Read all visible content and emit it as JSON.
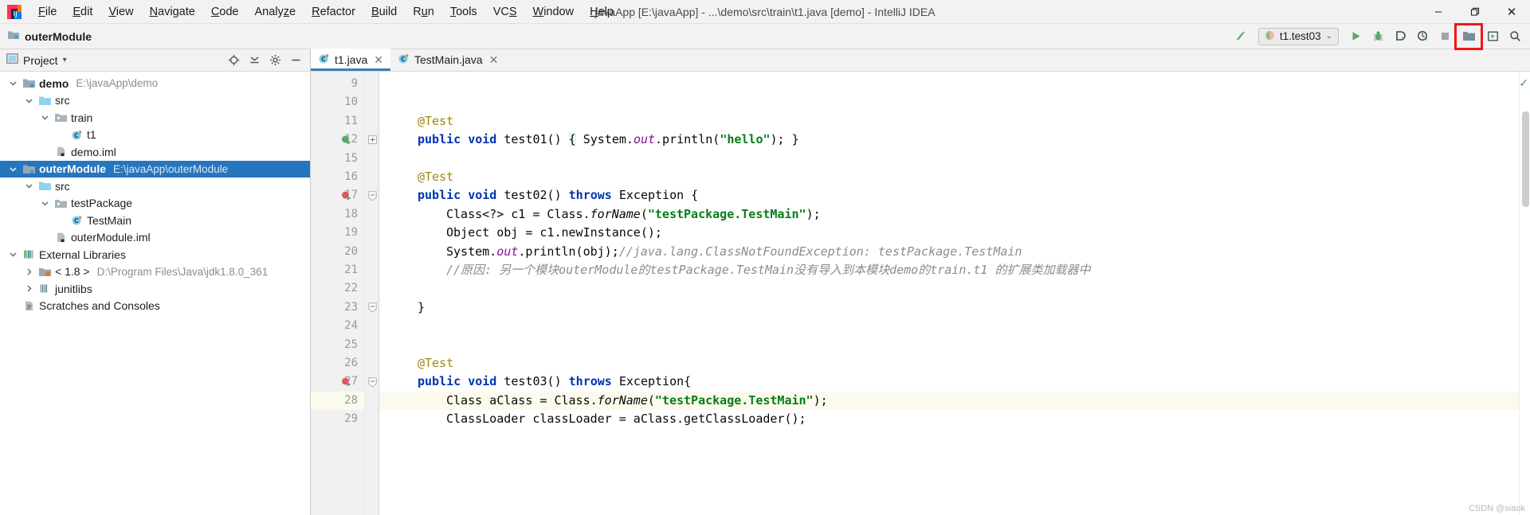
{
  "titlebar": {
    "logo_icon": "intellij-logo-icon",
    "menus": [
      {
        "label": "File",
        "mnemonic": "F"
      },
      {
        "label": "Edit",
        "mnemonic": "E"
      },
      {
        "label": "View",
        "mnemonic": "V"
      },
      {
        "label": "Navigate",
        "mnemonic": "N"
      },
      {
        "label": "Code",
        "mnemonic": "C"
      },
      {
        "label": "Analyze",
        "mnemonic": "z"
      },
      {
        "label": "Refactor",
        "mnemonic": "R"
      },
      {
        "label": "Build",
        "mnemonic": "B"
      },
      {
        "label": "Run",
        "mnemonic": "u"
      },
      {
        "label": "Tools",
        "mnemonic": "T"
      },
      {
        "label": "VCS",
        "mnemonic": "S"
      },
      {
        "label": "Window",
        "mnemonic": "W"
      },
      {
        "label": "Help",
        "mnemonic": "H"
      }
    ],
    "window_title": "javaApp [E:\\javaApp] - ...\\demo\\src\\train\\t1.java [demo] - IntelliJ IDEA",
    "minimize": "–",
    "maximize": "❐",
    "close": "✕"
  },
  "toolbar": {
    "breadcrumb_icon": "module-folder-icon",
    "breadcrumb_label": "outerModule",
    "build_icon": "build-hammer-icon",
    "run_config": {
      "icon": "junit-config-icon",
      "label": "t1.test03",
      "chevron": "⌄"
    },
    "actions": [
      {
        "name": "run-button",
        "icon": "play-icon"
      },
      {
        "name": "debug-button",
        "icon": "bug-icon"
      },
      {
        "name": "run-with-coverage-button",
        "icon": "coverage-icon"
      },
      {
        "name": "profile-button",
        "icon": "profiler-icon"
      },
      {
        "name": "stop-button",
        "icon": "stop-icon"
      },
      {
        "name": "project-structure-button",
        "icon": "project-structure-icon",
        "highlighted": true
      },
      {
        "name": "update-project-button",
        "icon": "update-icon"
      },
      {
        "name": "search-everywhere-button",
        "icon": "search-icon"
      }
    ],
    "highlight_color": "#f01616"
  },
  "project_panel": {
    "header": {
      "icon": "project-view-icon",
      "title": "Project",
      "chevron": "▾",
      "actions": [
        {
          "name": "select-opened-file-button",
          "icon": "crosshair-target-icon"
        },
        {
          "name": "collapse-all-button",
          "icon": "collapse-all-icon"
        },
        {
          "name": "settings-button",
          "icon": "gear-icon"
        },
        {
          "name": "hide-button",
          "icon": "minus-icon"
        }
      ]
    },
    "tree": [
      {
        "label": "demo",
        "path": "E:\\javaApp\\demo",
        "icon": "module-folder-icon",
        "indent": 0,
        "expanded": true,
        "bold": true,
        "selected": false
      },
      {
        "label": "src",
        "path": "",
        "icon": "source-folder-icon",
        "indent": 1,
        "expanded": true,
        "bold": false,
        "selected": false
      },
      {
        "label": "train",
        "path": "",
        "icon": "package-folder-icon",
        "indent": 2,
        "expanded": true,
        "bold": false,
        "selected": false
      },
      {
        "label": "t1",
        "path": "",
        "icon": "java-class-icon",
        "indent": 3,
        "expanded": null,
        "bold": false,
        "selected": false
      },
      {
        "label": "demo.iml",
        "path": "",
        "icon": "iml-file-icon",
        "indent": 2,
        "expanded": null,
        "bold": false,
        "selected": false
      },
      {
        "label": "outerModule",
        "path": "E:\\javaApp\\outerModule",
        "icon": "module-folder-icon",
        "indent": 0,
        "expanded": true,
        "bold": true,
        "selected": true
      },
      {
        "label": "src",
        "path": "",
        "icon": "source-folder-icon",
        "indent": 1,
        "expanded": true,
        "bold": false,
        "selected": false
      },
      {
        "label": "testPackage",
        "path": "",
        "icon": "package-folder-icon",
        "indent": 2,
        "expanded": true,
        "bold": false,
        "selected": false
      },
      {
        "label": "TestMain",
        "path": "",
        "icon": "java-class-icon",
        "indent": 3,
        "expanded": null,
        "bold": false,
        "selected": false
      },
      {
        "label": "outerModule.iml",
        "path": "",
        "icon": "iml-file-icon",
        "indent": 2,
        "expanded": null,
        "bold": false,
        "selected": false
      },
      {
        "label": "External Libraries",
        "path": "",
        "icon": "libraries-icon",
        "indent": 0,
        "expanded": true,
        "bold": false,
        "selected": false
      },
      {
        "label": "< 1.8 >",
        "path": "D:\\Program Files\\Java\\jdk1.8.0_361",
        "icon": "jdk-icon",
        "indent": 1,
        "expanded": false,
        "bold": false,
        "selected": false
      },
      {
        "label": "junitlibs",
        "path": "",
        "icon": "library-icon",
        "indent": 1,
        "expanded": false,
        "bold": false,
        "selected": false
      },
      {
        "label": "Scratches and Consoles",
        "path": "",
        "icon": "scratches-icon",
        "indent": 0,
        "expanded": null,
        "bold": false,
        "selected": false
      }
    ]
  },
  "editor": {
    "tabs": [
      {
        "label": "t1.java",
        "icon": "java-class-icon",
        "active": true,
        "close": "✕"
      },
      {
        "label": "TestMain.java",
        "icon": "java-class-icon",
        "active": false,
        "close": "✕"
      }
    ],
    "highlighted_line": 28,
    "inspection_status_icon": "check-ok-icon",
    "lines": [
      {
        "num": 9,
        "indent": 0,
        "marker": "",
        "fold": "",
        "tokens": []
      },
      {
        "num": 10,
        "indent": 0,
        "marker": "",
        "fold": "",
        "tokens": []
      },
      {
        "num": 11,
        "indent": 1,
        "marker": "",
        "fold": "",
        "tokens": [
          {
            "t": "ann",
            "s": "@Test"
          }
        ]
      },
      {
        "num": 12,
        "indent": 1,
        "marker": "run-test-green",
        "fold": "+",
        "tokens": [
          {
            "t": "kw",
            "s": "public"
          },
          {
            "t": "pl",
            "s": " "
          },
          {
            "t": "kw",
            "s": "void"
          },
          {
            "t": "pl",
            "s": " test01() "
          },
          {
            "t": "brace",
            "s": "{"
          },
          {
            "t": "pl",
            "s": " System."
          },
          {
            "t": "fld",
            "s": "out"
          },
          {
            "t": "pl",
            "s": ".println("
          },
          {
            "t": "str",
            "s": "\"hello\""
          },
          {
            "t": "pl",
            "s": "); }"
          }
        ]
      },
      {
        "num": 15,
        "indent": 0,
        "marker": "",
        "fold": "",
        "tokens": []
      },
      {
        "num": 16,
        "indent": 1,
        "marker": "",
        "fold": "",
        "tokens": [
          {
            "t": "ann",
            "s": "@Test"
          }
        ]
      },
      {
        "num": 17,
        "indent": 1,
        "marker": "run-test-failed",
        "fold": "-",
        "tokens": [
          {
            "t": "kw",
            "s": "public"
          },
          {
            "t": "pl",
            "s": " "
          },
          {
            "t": "kw",
            "s": "void"
          },
          {
            "t": "pl",
            "s": " test02() "
          },
          {
            "t": "kw",
            "s": "throws"
          },
          {
            "t": "pl",
            "s": " Exception {"
          }
        ]
      },
      {
        "num": 18,
        "indent": 2,
        "marker": "",
        "fold": "",
        "tokens": [
          {
            "t": "pl",
            "s": "Class<?> c1 = Class."
          },
          {
            "t": "mth",
            "s": "forName"
          },
          {
            "t": "pl",
            "s": "("
          },
          {
            "t": "str",
            "s": "\"testPackage.TestMain\""
          },
          {
            "t": "pl",
            "s": ");"
          }
        ]
      },
      {
        "num": 19,
        "indent": 2,
        "marker": "",
        "fold": "",
        "tokens": [
          {
            "t": "pl",
            "s": "Object obj = c1.newInstance();"
          }
        ]
      },
      {
        "num": 20,
        "indent": 2,
        "marker": "",
        "fold": "",
        "tokens": [
          {
            "t": "pl",
            "s": "System."
          },
          {
            "t": "fld",
            "s": "out"
          },
          {
            "t": "pl",
            "s": ".println(obj);"
          },
          {
            "t": "cmt",
            "s": "//java.lang.ClassNotFoundException: testPackage.TestMain"
          }
        ]
      },
      {
        "num": 21,
        "indent": 2,
        "marker": "",
        "fold": "",
        "tokens": [
          {
            "t": "cmt",
            "s": "//原因: 另一个模块outerModule的testPackage.TestMain没有导入到本模块demo的train.t1 的扩展类加载器中"
          }
        ]
      },
      {
        "num": 22,
        "indent": 0,
        "marker": "",
        "fold": "",
        "tokens": []
      },
      {
        "num": 23,
        "indent": 1,
        "marker": "",
        "fold": "-",
        "tokens": [
          {
            "t": "pl",
            "s": "}"
          }
        ]
      },
      {
        "num": 24,
        "indent": 0,
        "marker": "",
        "fold": "",
        "tokens": []
      },
      {
        "num": 25,
        "indent": 0,
        "marker": "",
        "fold": "",
        "tokens": []
      },
      {
        "num": 26,
        "indent": 1,
        "marker": "",
        "fold": "",
        "tokens": [
          {
            "t": "ann",
            "s": "@Test"
          }
        ]
      },
      {
        "num": 27,
        "indent": 1,
        "marker": "run-test-failed",
        "fold": "-",
        "tokens": [
          {
            "t": "kw",
            "s": "public"
          },
          {
            "t": "pl",
            "s": " "
          },
          {
            "t": "kw",
            "s": "void"
          },
          {
            "t": "pl",
            "s": " test03() "
          },
          {
            "t": "kw",
            "s": "throws"
          },
          {
            "t": "pl",
            "s": " Exception{"
          }
        ]
      },
      {
        "num": 28,
        "indent": 2,
        "marker": "",
        "fold": "",
        "tokens": [
          {
            "t": "pl",
            "s": "Class aClass = Class."
          },
          {
            "t": "mth",
            "s": "forName"
          },
          {
            "t": "pl",
            "s": "("
          },
          {
            "t": "str",
            "s": "\"testPackage.TestMain\""
          },
          {
            "t": "pl",
            "s": ");"
          }
        ]
      },
      {
        "num": 29,
        "indent": 2,
        "marker": "",
        "fold": "",
        "tokens": [
          {
            "t": "pl",
            "s": "ClassLoader classLoader = aClass.getClassLoader();"
          }
        ]
      }
    ]
  },
  "watermark": "CSDN @siaok"
}
